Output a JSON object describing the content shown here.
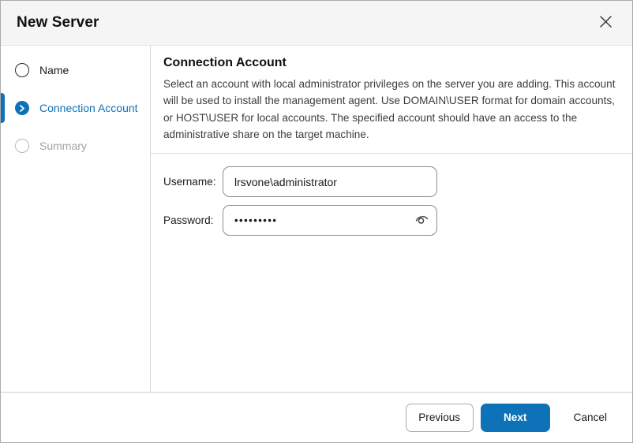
{
  "accent_color": "#0e72b8",
  "dialog": {
    "title": "New Server"
  },
  "sidebar": {
    "steps": [
      {
        "label": "Name",
        "state": "pending"
      },
      {
        "label": "Connection Account",
        "state": "active"
      },
      {
        "label": "Summary",
        "state": "disabled"
      }
    ]
  },
  "content": {
    "heading": "Connection Account",
    "description": "Select an account with local administrator privileges on the server you are adding. This account will be used to install the management agent. Use DOMAIN\\USER format for domain accounts, or HOST\\USER for local accounts. The specified account should have an access to the administrative share on the target machine.",
    "form": {
      "username_label": "Username:",
      "username_value": "lrsvone\\administrator",
      "password_label": "Password:",
      "password_value": "•••••••••"
    }
  },
  "footer": {
    "previous_label": "Previous",
    "next_label": "Next",
    "cancel_label": "Cancel"
  }
}
